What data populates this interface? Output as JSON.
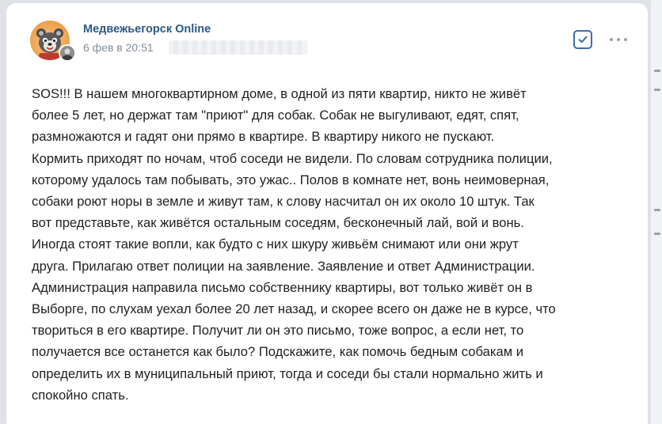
{
  "post": {
    "group_name": "Медвежьегорск Online",
    "timestamp": "6 фев в 20:51",
    "text": "SOS!!! В нашем многоквартирном доме, в одной из пяти квартир, никто не живёт\nболее 5 лет, но держат там \"приют\" для собак. Собак не выгуливают, едят, спят,\nразмножаются и гадят они прямо в квартире. В квартиру никого не пускают.\nКормить приходят по ночам, чтоб соседи не видели. По словам сотрудника полиции,\nкоторому удалось там побывать, это ужас.. Полов в комнате нет, вонь неимоверная,\nсобаки роют норы в земле и живут там, к слову насчитал он их около 10 штук. Так\nвот представьте, как живётся остальным соседям, бесконечный лай, вой и вонь.\nИногда стоят такие вопли, как будто с них шкуру живьём снимают или они жрут\nдруга. Прилагаю ответ полиции на заявление. Заявление и ответ Администрации.\nАдминистрация направила письмо собственнику квартиры, вот только живёт он в\nВыборге, по слухам уехал более 20 лет назад, и скорее всего он даже не в курсе, что\nтвориться в его квартире. Получит ли он это письмо, тоже вопрос, а если нет, то\nполучается все останется как было? Подскажите, как помочь бедным собакам и\nопределить их в муниципальный приют, тогда и соседи бы стали нормально жить и\nспокойно спать."
  },
  "icons": {
    "avatar": "bear-mascot-avatar",
    "sub_avatar": "author-avatar",
    "check": "checkbox-checked-icon",
    "more": "more-horizontal-icon"
  },
  "colors": {
    "link": "#2a5885",
    "meta": "#818c99",
    "accent": "#3f6ab3",
    "avatar_bg": "#f0a857"
  }
}
